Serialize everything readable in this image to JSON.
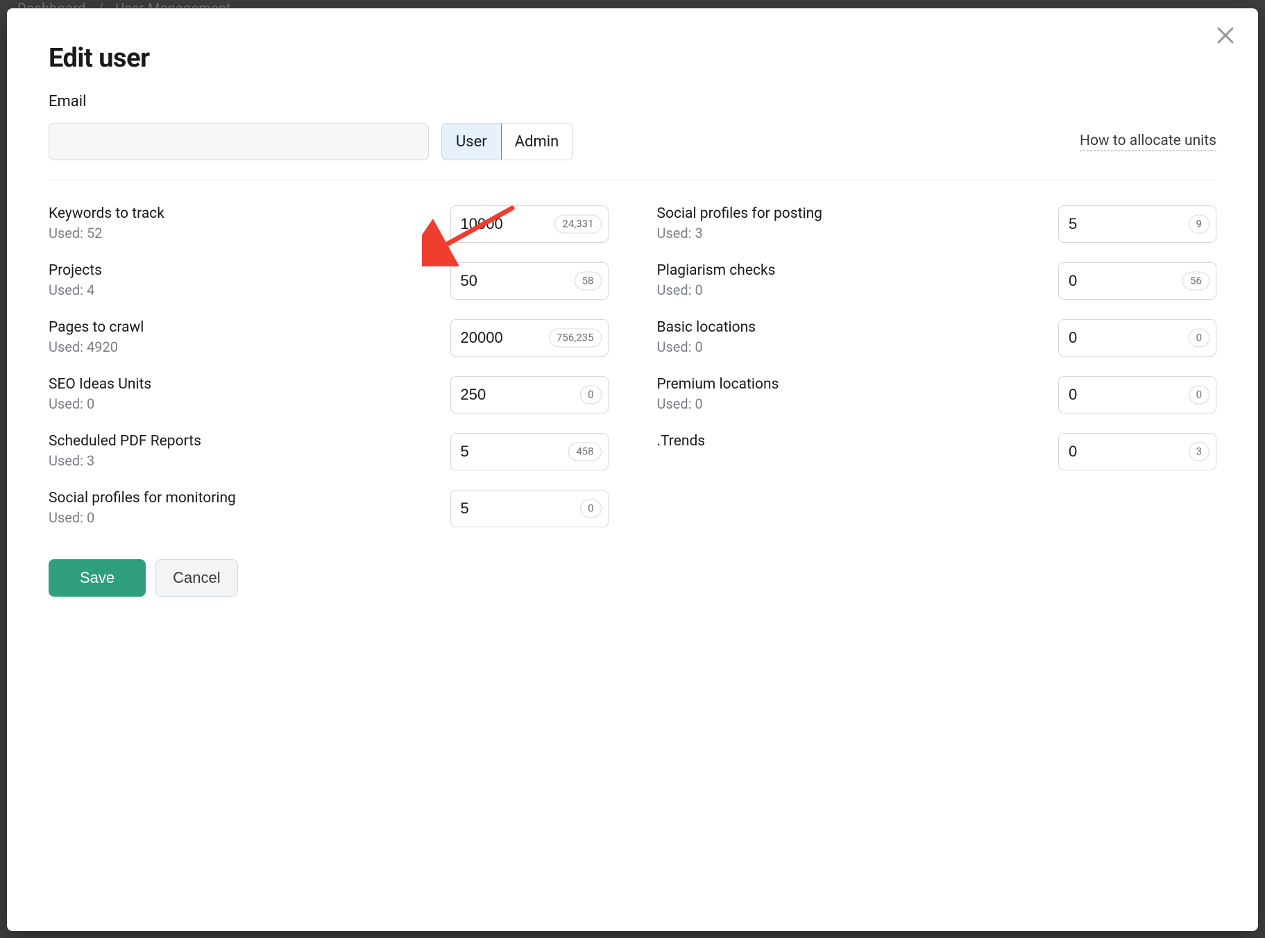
{
  "breadcrumb": {
    "item1": "Dashboard",
    "item2": "User Management"
  },
  "modal": {
    "title": "Edit user",
    "email_label": "Email",
    "email_value": "",
    "role": {
      "user": "User",
      "admin": "Admin"
    },
    "alloc_link": "How to allocate units",
    "used_prefix": "Used: "
  },
  "limits_left": [
    {
      "key": "keywords",
      "name": "Keywords to track",
      "used": "52",
      "value": "10000",
      "badge": "24,331"
    },
    {
      "key": "projects",
      "name": "Projects",
      "used": "4",
      "value": "50",
      "badge": "58"
    },
    {
      "key": "pages",
      "name": "Pages to crawl",
      "used": "4920",
      "value": "20000",
      "badge": "756,235"
    },
    {
      "key": "seo",
      "name": "SEO Ideas Units",
      "used": "0",
      "value": "250",
      "badge": "0"
    },
    {
      "key": "pdf",
      "name": "Scheduled PDF Reports",
      "used": "3",
      "value": "5",
      "badge": "458"
    },
    {
      "key": "soc_mon",
      "name": "Social profiles for monitoring",
      "used": "0",
      "value": "5",
      "badge": "0"
    }
  ],
  "limits_right": [
    {
      "key": "soc_post",
      "name": "Social profiles for posting",
      "used": "3",
      "value": "5",
      "badge": "9"
    },
    {
      "key": "plag",
      "name": "Plagiarism checks",
      "used": "0",
      "value": "0",
      "badge": "56"
    },
    {
      "key": "basic_loc",
      "name": "Basic locations",
      "used": "0",
      "value": "0",
      "badge": "0"
    },
    {
      "key": "prem_loc",
      "name": "Premium locations",
      "used": "0",
      "value": "0",
      "badge": "0"
    },
    {
      "key": "trends",
      "name": ".Trends",
      "value": "0",
      "badge": "3"
    }
  ],
  "actions": {
    "save": "Save",
    "cancel": "Cancel"
  }
}
